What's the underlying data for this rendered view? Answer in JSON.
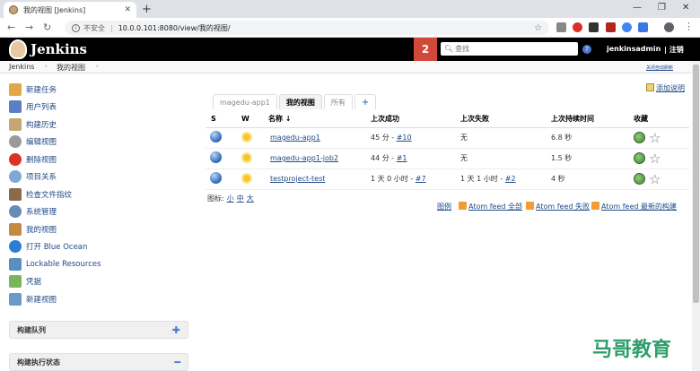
{
  "browser": {
    "tab_title": "我的视图 [Jenkins]",
    "url": "10.0.0.101:8080/view/我的视图/",
    "security_label": "不安全"
  },
  "header": {
    "app_name": "Jenkins",
    "notification_count": "2",
    "search_placeholder": "查找",
    "username": "jenkinsadmin",
    "logout": "| 注销"
  },
  "breadcrumb": {
    "items": [
      "Jenkins",
      "我的视图"
    ],
    "auto_refresh": "关闭自动刷新"
  },
  "sidebar": {
    "items": [
      {
        "label": "新建任务",
        "icon": "new-item-icon",
        "color": "#e2a845"
      },
      {
        "label": "用户列表",
        "icon": "users-icon",
        "color": "#5b7fc5"
      },
      {
        "label": "构建历史",
        "icon": "history-icon",
        "color": "#c8a672"
      },
      {
        "label": "编辑视图",
        "icon": "gear-icon",
        "color": "#9a9a9a"
      },
      {
        "label": "删除视图",
        "icon": "delete-icon",
        "color": "#d9332a"
      },
      {
        "label": "项目关系",
        "icon": "search-icon",
        "color": "#7fa7d8"
      },
      {
        "label": "检查文件指纹",
        "icon": "fingerprint-icon",
        "color": "#8a6a4a"
      },
      {
        "label": "系统管理",
        "icon": "manage-icon",
        "color": "#6a8ab5"
      },
      {
        "label": "我的视图",
        "icon": "user-icon",
        "color": "#c58a3f"
      },
      {
        "label": "打开 Blue Ocean",
        "icon": "blue-ocean-icon",
        "color": "#2a7fd4"
      },
      {
        "label": "Lockable Resources",
        "icon": "lock-icon",
        "color": "#5a8fbf"
      },
      {
        "label": "凭据",
        "icon": "credentials-icon",
        "color": "#7ab55c"
      },
      {
        "label": "新建视图",
        "icon": "folder-icon",
        "color": "#6a9ac8"
      }
    ]
  },
  "panes": {
    "build_queue": "构建队列",
    "executor_status": "构建执行状态"
  },
  "main": {
    "add_description": "添加说明",
    "tabs": [
      "magedu-app1",
      "我的视图",
      "所有",
      "+"
    ],
    "active_tab": "我的视图",
    "columns": [
      "S",
      "W",
      "名称 ↓",
      "上次成功",
      "上次失败",
      "上次持续时间",
      "收藏"
    ],
    "jobs": [
      {
        "name": "magedu-app1",
        "last_success_time": "45 分 - ",
        "last_success_build": "#10",
        "last_failure_time": "无",
        "last_failure_build": "",
        "duration": "6.8 秒"
      },
      {
        "name": "magedu-app1-job2",
        "last_success_time": "44 分 - ",
        "last_success_build": "#1",
        "last_failure_time": "无",
        "last_failure_build": "",
        "duration": "1.5 秒"
      },
      {
        "name": "testproject-test",
        "last_success_time": "1 天 0 小时 - ",
        "last_success_build": "#7",
        "last_failure_time": "1 天 1 小时 - ",
        "last_failure_build": "#2",
        "duration": "4 秒"
      }
    ],
    "icon_size_label": "图标:",
    "icon_sizes": [
      "小",
      "中",
      "大"
    ],
    "legend": "图例",
    "feeds": [
      "Atom feed 全部",
      "Atom feed 失败",
      "Atom feed 最新的构建"
    ]
  },
  "watermark": "马哥教育"
}
